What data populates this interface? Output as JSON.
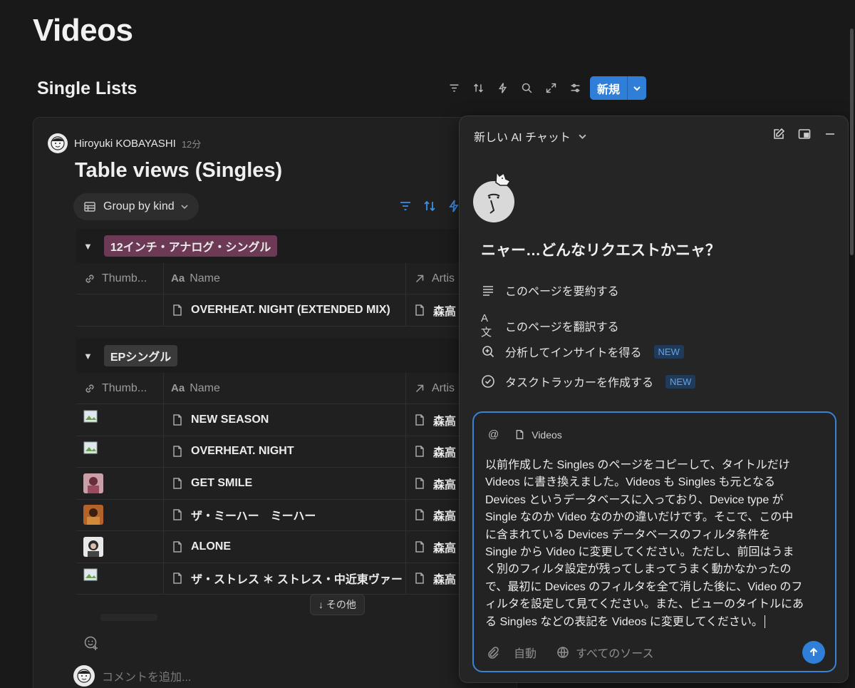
{
  "page": {
    "title": "Videos"
  },
  "database": {
    "title": "Single Lists"
  },
  "toolbar": {
    "new_label": "新規"
  },
  "card": {
    "author": "Hiroyuki KOBAYASHI",
    "time": "12分",
    "title": "Table views (Singles)",
    "group_chip": "Group by kind",
    "more_label": "↓ その他",
    "comment_placeholder": "コメントを追加..."
  },
  "columns": {
    "thumb": "Thumb...",
    "name": "Name",
    "artist": "Artis"
  },
  "groups": [
    {
      "tag": "12インチ・アナログ・シングル",
      "rows": [
        {
          "name": "OVERHEAT. NIGHT (EXTENDED MIX)",
          "artist": "森高"
        }
      ]
    },
    {
      "tag": "EPシングル",
      "rows": [
        {
          "name": "NEW SEASON",
          "artist": "森高"
        },
        {
          "name": "OVERHEAT. NIGHT",
          "artist": "森高"
        },
        {
          "name": "GET SMILE",
          "artist": "森高"
        },
        {
          "name": "ザ・ミーハー　ミーハー",
          "artist": "森高"
        },
        {
          "name": "ALONE",
          "artist": "森高"
        },
        {
          "name": "ザ・ストレス ＊ ストレス・中近東ヴァー",
          "artist": "森高"
        }
      ]
    }
  ],
  "ai": {
    "header": "新しい AI チャット",
    "greeting": "ニャー…どんなリクエストかニャ？",
    "suggestions": [
      {
        "label": "このページを要約する",
        "icon": "lines-icon"
      },
      {
        "label": "このページを翻訳する",
        "icon": "translate-icon",
        "glyph": "A文"
      },
      {
        "label": "分析してインサイトを得る",
        "icon": "zoom-plus-icon",
        "badge": "NEW"
      },
      {
        "label": "タスクトラッカーを作成する",
        "icon": "check-circle-icon",
        "badge": "NEW"
      }
    ],
    "composer": {
      "at": "@",
      "context_page": "Videos",
      "message": "以前作成した Singles のページをコピーして、タイトルだけ\nVideos に書き換えました。Videos も Singles も元となる\nDevices というデータベースに入っており、Device type が\nSingle なのか Video なのかの違いだけです。そこで、この中\nに含まれている Devices データベースのフィルタ条件を\nSingle から Video に変更してください。ただし、前回はうま\nく別のフィルタ設定が残ってしまってうまく動かなかったの\nで、最初に Devices のフィルタを全て消した後に、Video のフ\nィルタを設定して見てください。また、ビューのタイトルにあ\nる Singles などの表記を Videos に変更してください。",
      "mode": "自動",
      "sources": "すべてのソース"
    }
  },
  "colors": {
    "accent": "#2f7fd9",
    "tag_pink": "#6d3a55",
    "tag_gray": "#3a3a3a",
    "badge_new": "#5fa3ea"
  }
}
